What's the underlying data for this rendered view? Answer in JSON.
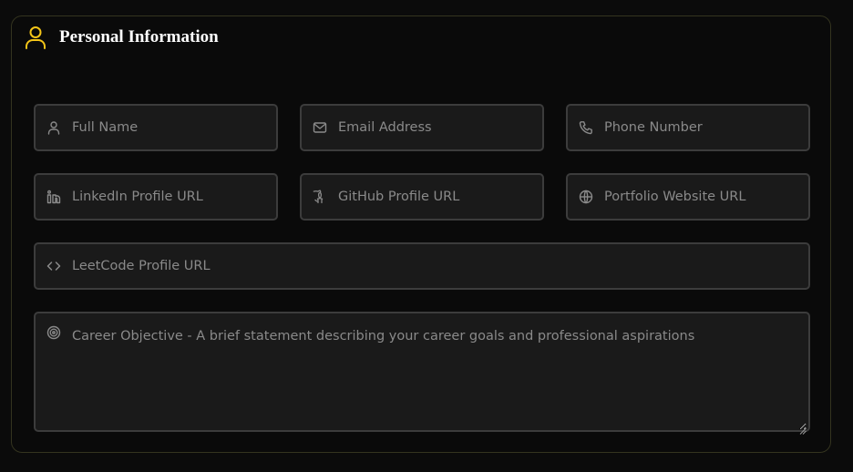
{
  "section": {
    "title": "Personal Information",
    "icon": "user-icon",
    "accent_color": "#f5c518"
  },
  "fields": {
    "full_name": {
      "placeholder": "Full Name",
      "value": "",
      "icon": "user-icon"
    },
    "email": {
      "placeholder": "Email Address",
      "value": "",
      "icon": "mail-icon"
    },
    "phone": {
      "placeholder": "Phone Number",
      "value": "",
      "icon": "phone-icon"
    },
    "linkedin": {
      "placeholder": "LinkedIn Profile URL",
      "value": "",
      "icon": "linkedin-icon"
    },
    "github": {
      "placeholder": "GitHub Profile URL",
      "value": "",
      "icon": "github-icon"
    },
    "portfolio": {
      "placeholder": "Portfolio Website URL",
      "value": "",
      "icon": "globe-icon"
    },
    "leetcode": {
      "placeholder": "LeetCode Profile URL",
      "value": "",
      "icon": "code-icon"
    },
    "career_objective": {
      "placeholder": "Career Objective - A brief statement describing your career goals and professional aspirations",
      "value": "",
      "icon": "target-icon"
    }
  }
}
